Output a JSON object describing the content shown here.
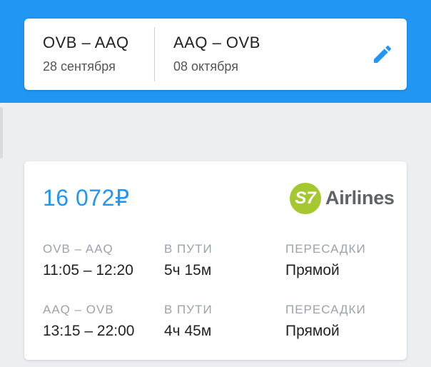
{
  "route_summary": {
    "outbound": {
      "route": "OVB – AAQ",
      "date": "28 сентября"
    },
    "return": {
      "route": "AAQ – OVB",
      "date": "08 октября"
    },
    "edit_icon": "pencil-icon"
  },
  "result": {
    "price": "16 072₽",
    "airline": {
      "logo_mark": "S7",
      "name": "Airlines",
      "logo_color": "#a5c730"
    },
    "segments": [
      {
        "route": "OVB – AAQ",
        "times": "11:05 – 12:20",
        "duration_label": "В ПУТИ",
        "duration": "5ч 15м",
        "transfers_label": "ПЕРЕСАДКИ",
        "transfers": "Прямой"
      },
      {
        "route": "AAQ – OVB",
        "times": "13:15 – 22:00",
        "duration_label": "В ПУТИ",
        "duration": "4ч 45м",
        "transfers_label": "ПЕРЕСАДКИ",
        "transfers": "Прямой"
      }
    ]
  },
  "colors": {
    "accent": "#2196f3",
    "background": "#eceef1"
  }
}
